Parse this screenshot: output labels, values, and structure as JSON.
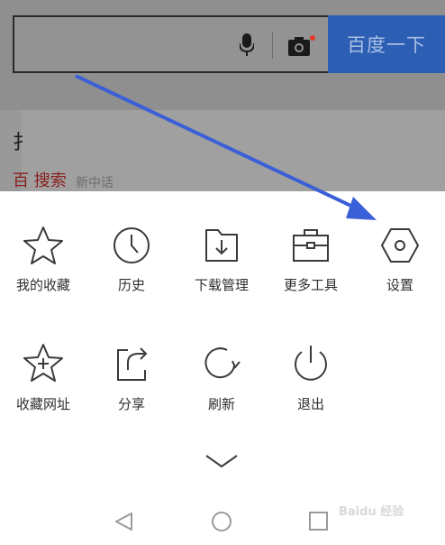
{
  "search": {
    "button_label": "百度一下"
  },
  "behind": {
    "text1": "扌",
    "text2": "百 搜索",
    "text3": "新中话"
  },
  "menu": {
    "row1": [
      {
        "label": "我的收藏",
        "icon": "star-icon"
      },
      {
        "label": "历史",
        "icon": "clock-icon"
      },
      {
        "label": "下载管理",
        "icon": "download-folder-icon"
      },
      {
        "label": "更多工具",
        "icon": "toolbox-icon"
      },
      {
        "label": "设置",
        "icon": "settings-hexagon-icon"
      }
    ],
    "row2": [
      {
        "label": "收藏网址",
        "icon": "star-plus-icon"
      },
      {
        "label": "分享",
        "icon": "share-icon"
      },
      {
        "label": "刷新",
        "icon": "refresh-icon"
      },
      {
        "label": "退出",
        "icon": "power-icon"
      }
    ]
  },
  "watermark": "Baidu 经验",
  "colors": {
    "accent": "#2c5fb4",
    "arrow": "#3b5fd6",
    "camera_dot": "#e3392b"
  }
}
